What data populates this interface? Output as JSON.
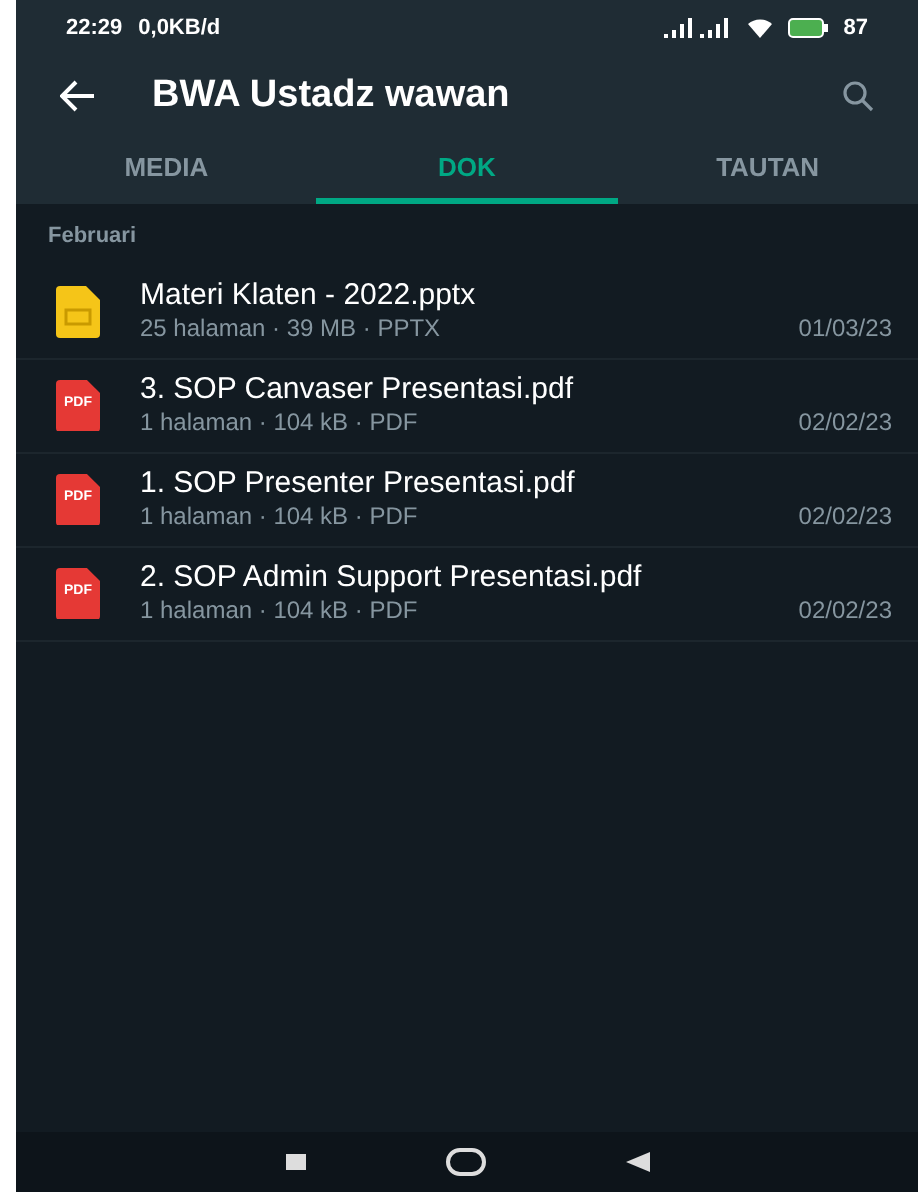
{
  "status_bar": {
    "time": "22:29",
    "speed": "0,0KB/d",
    "battery": "87"
  },
  "app_bar": {
    "title": "BWA Ustadz wawan"
  },
  "tabs": [
    {
      "label": "MEDIA",
      "selected": false
    },
    {
      "label": "DOK",
      "selected": true
    },
    {
      "label": "TAUTAN",
      "selected": false
    }
  ],
  "section": "Februari",
  "files": [
    {
      "kind": "slides",
      "name": "Materi Klaten - 2022.pptx",
      "details": "25 halaman · 39 MB · PPTX",
      "date": "01/03/23"
    },
    {
      "kind": "pdf",
      "icon_label": "PDF",
      "name": "3. SOP Canvaser Presentasi.pdf",
      "details": "1 halaman · 104 kB · PDF",
      "date": "02/02/23"
    },
    {
      "kind": "pdf",
      "icon_label": "PDF",
      "name": "1. SOP Presenter Presentasi.pdf",
      "details": "1 halaman · 104 kB · PDF",
      "date": "02/02/23"
    },
    {
      "kind": "pdf",
      "icon_label": "PDF",
      "name": "2. SOP Admin Support Presentasi.pdf",
      "details": "1 halaman · 104 kB · PDF",
      "date": "02/02/23"
    }
  ]
}
